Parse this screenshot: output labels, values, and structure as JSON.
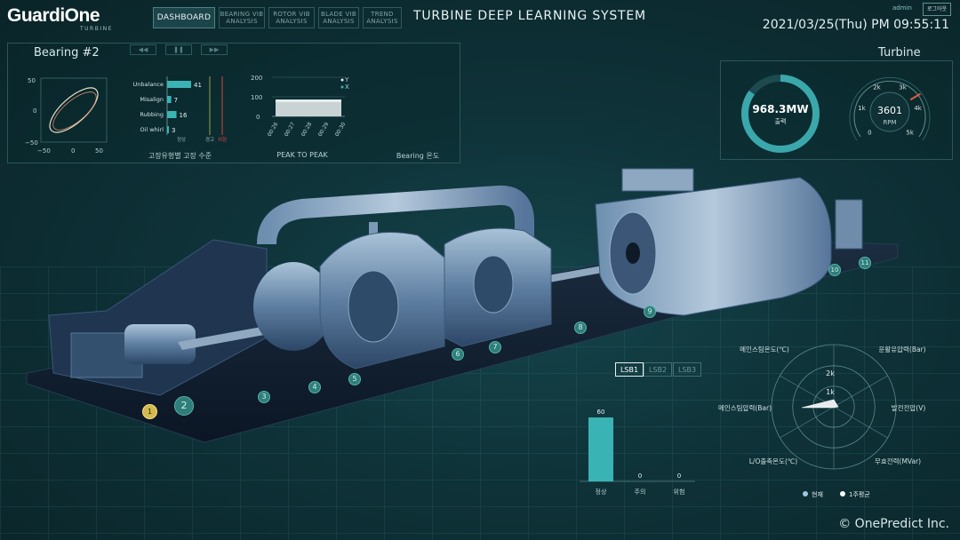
{
  "header": {
    "logo": "GuardiOne",
    "logo_sub": "TURBINE",
    "nav": [
      {
        "label": "DASHBOARD",
        "active": true
      },
      {
        "label": "BEARING VIB ANALYSIS",
        "active": false
      },
      {
        "label": "ROTOR VIB ANALYSIS",
        "active": false
      },
      {
        "label": "BLADE VIB ANALYSIS",
        "active": false
      },
      {
        "label": "TREND ANALYSIS",
        "active": false
      }
    ],
    "title": "TURBINE DEEP LEARNING SYSTEM",
    "datetime": "2021/03/25(Thu) PM 09:55:11",
    "user": "admin",
    "logout": "로그아웃"
  },
  "bearing_panel": {
    "title": "Bearing #2",
    "controls": [
      "◀◀",
      "❚❚",
      "▶▶"
    ],
    "orbit": {
      "y_ticks": [
        "50",
        "0",
        "−50"
      ],
      "x_ticks": [
        "−50",
        "0",
        "50"
      ]
    },
    "fault_chart": {
      "caption": "고장유형별 고장 수준",
      "items": [
        {
          "label": "Unbalance",
          "value": 41
        },
        {
          "label": "Misalign",
          "value": 7
        },
        {
          "label": "Rubbing",
          "value": 16
        },
        {
          "label": "Oil whirl",
          "value": 3
        }
      ],
      "max": 41,
      "levels": [
        "정상",
        "경고",
        "위험"
      ]
    },
    "peak_chart": {
      "caption": "PEAK TO PEAK",
      "y_ticks": [
        "200",
        "100",
        "0"
      ],
      "x_ticks": [
        "00:26",
        "00:27",
        "00:28",
        "00:29",
        "00:30"
      ],
      "legend": [
        "Y",
        "X"
      ]
    },
    "bearing_temp_caption": "Bearing 온도"
  },
  "turbine_panel": {
    "title": "Turbine",
    "output_value": "968.3MW",
    "output_label": "출력",
    "output_fraction": 0.85,
    "rpm_value": "3601",
    "rpm_unit": "RPM",
    "rpm_ticks": [
      "0",
      "1k",
      "2k",
      "3k",
      "4k",
      "5k"
    ],
    "rpm_reading": 3601
  },
  "markers": [
    "1",
    "2",
    "3",
    "4",
    "5",
    "6",
    "7",
    "8",
    "9",
    "10",
    "11"
  ],
  "lsb": {
    "tabs": [
      {
        "label": "LSB1",
        "active": true
      },
      {
        "label": "LSB2",
        "active": false
      },
      {
        "label": "LSB3",
        "active": false
      }
    ],
    "bars": [
      {
        "label": "정상",
        "value": 60
      },
      {
        "label": "주의",
        "value": 0
      },
      {
        "label": "위험",
        "value": 0
      }
    ]
  },
  "radar": {
    "axes": [
      "메인스팀온도(℃)",
      "윤활유압력(Bar)",
      "발전전압(V)",
      "무효전력(MVar)",
      "L/O출축온도(℃)",
      "메인스팀압력(Bar)"
    ],
    "rings": [
      "2k",
      "1k"
    ],
    "legend": [
      "현재",
      "1주평균"
    ]
  },
  "copyright": "© OnePredict Inc.",
  "colors": {
    "accent": "#2fa2a6",
    "bar": "#3ab3b5",
    "danger": "#d9433a",
    "warning": "#9aa04a"
  }
}
